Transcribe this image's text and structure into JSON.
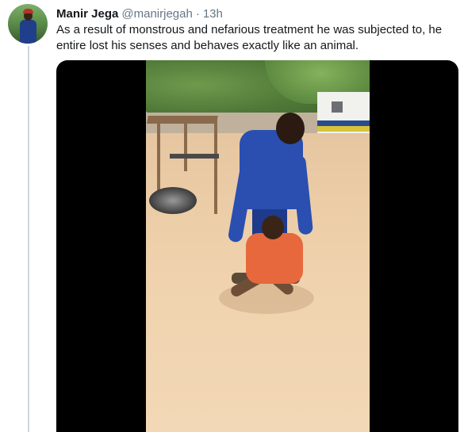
{
  "tweet": {
    "author_name": "Manir Jega",
    "author_handle": "@manirjegah",
    "separator": "·",
    "timestamp": "13h",
    "text": "As a result of monstrous and nefarious treatment he was subjected to, he entire lost his senses and behaves exactly like an animal."
  }
}
